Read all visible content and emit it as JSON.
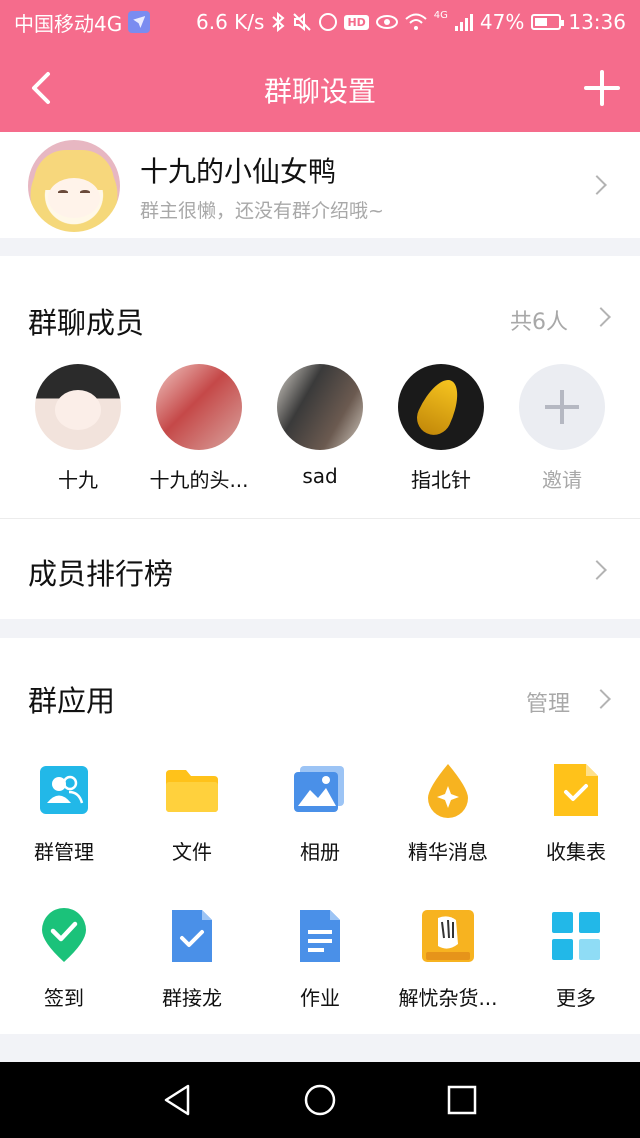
{
  "status_bar": {
    "carrier": "中国移动4G",
    "speed": "6.6 K/s",
    "network": "4G",
    "battery": "47%",
    "time": "13:36"
  },
  "header": {
    "title": "群聊设置"
  },
  "group": {
    "name": "十九的小仙女鸭",
    "description": "群主很懒，还没有群介绍哦~"
  },
  "members": {
    "title": "群聊成员",
    "count_label": "共6人",
    "items": [
      {
        "name": "十九"
      },
      {
        "name": "十九的头..."
      },
      {
        "name": "sad"
      },
      {
        "name": "指北针"
      }
    ],
    "invite_label": "邀请"
  },
  "ranking": {
    "title": "成员排行榜"
  },
  "apps": {
    "title": "群应用",
    "manage_label": "管理",
    "items": [
      {
        "label": "群管理",
        "icon": "group-manage-icon",
        "color": "#22b8e8"
      },
      {
        "label": "文件",
        "icon": "folder-icon",
        "color": "#ffc21a"
      },
      {
        "label": "相册",
        "icon": "photo-album-icon",
        "color": "#4a90e8"
      },
      {
        "label": "精华消息",
        "icon": "essence-drop-icon",
        "color": "#f7b320"
      },
      {
        "label": "收集表",
        "icon": "collection-form-icon",
        "color": "#ffc21a"
      },
      {
        "label": "签到",
        "icon": "check-in-icon",
        "color": "#1bc27a"
      },
      {
        "label": "群接龙",
        "icon": "relay-icon",
        "color": "#4a90e8"
      },
      {
        "label": "作业",
        "icon": "homework-icon",
        "color": "#4a90e8"
      },
      {
        "label": "解忧杂货...",
        "icon": "grocery-store-icon",
        "color": "#f7b320"
      },
      {
        "label": "更多",
        "icon": "more-grid-icon",
        "color": "#22b8e8"
      }
    ]
  },
  "colors": {
    "accent": "#f56c8c",
    "secondary_text": "#a8a8a8"
  }
}
